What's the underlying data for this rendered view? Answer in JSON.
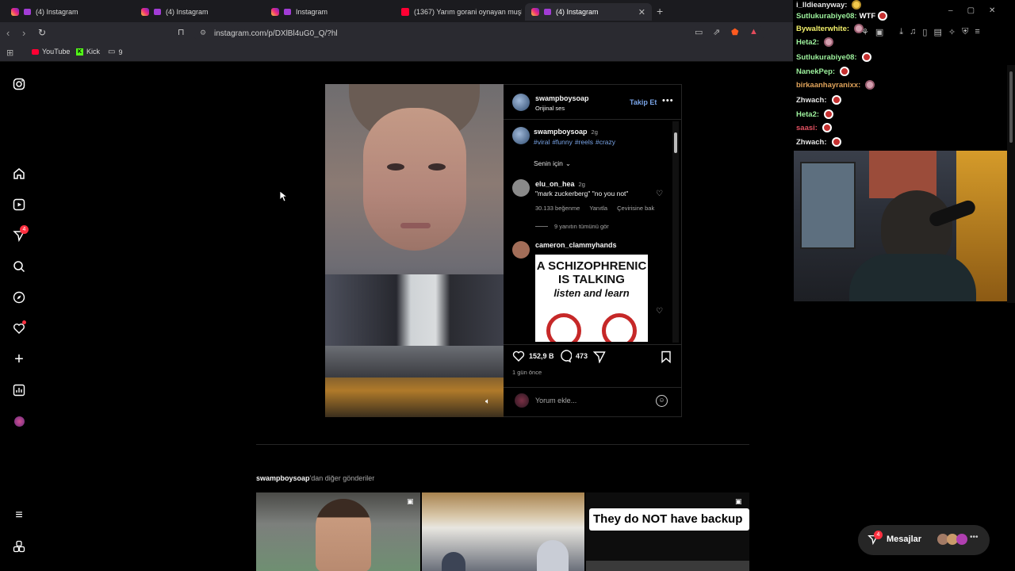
{
  "tabs": [
    {
      "label": "(4) Instagram",
      "icon": "instagram-icon"
    },
    {
      "label": "(4) Instagram",
      "icon": "instagram-icon"
    },
    {
      "label": "Instagram",
      "icon": "instagram-icon"
    },
    {
      "label": "(1367) Yarım gorani oynayan muşlu k",
      "icon": "youtube-icon"
    },
    {
      "label": "(4) Instagram",
      "icon": "instagram-icon"
    }
  ],
  "browser": {
    "url": "instagram.com/p/DXlBl4uG0_Q/?hl",
    "bookmarks": [
      {
        "label": "YouTube",
        "icon": "youtube-icon"
      },
      {
        "label": "Kick",
        "icon": "kick-icon"
      },
      {
        "label": "9",
        "icon": "folder-icon"
      }
    ]
  },
  "chat": [
    {
      "user": "i_lldieanyway:",
      "text": "",
      "color": "#e6e6e6"
    },
    {
      "user": "Sutlukurabiye08:",
      "text": "WTF",
      "color": "#9df29d"
    },
    {
      "user": "Bywalterwhite:",
      "text": "",
      "color": "#f2f06a"
    },
    {
      "user": "Heta2:",
      "text": "",
      "color": "#9df29d"
    },
    {
      "user": "Sutlukurabiye08:",
      "text": "",
      "color": "#9df29d"
    },
    {
      "user": "NanekPep:",
      "text": "",
      "color": "#9df29d"
    },
    {
      "user": "birkaanhayranixx:",
      "text": "",
      "color": "#e0a35a"
    },
    {
      "user": "Zhwach:",
      "text": "",
      "color": "#e6e6e6"
    },
    {
      "user": "Heta2:",
      "text": "",
      "color": "#9df29d"
    },
    {
      "user": "saasi:",
      "text": "",
      "color": "#e05060"
    },
    {
      "user": "Zhwach:",
      "text": "",
      "color": "#e6e6e6"
    }
  ],
  "post": {
    "author": "swampboysoap",
    "audio": "Orijinal ses",
    "follow_label": "Takip Et",
    "caption_user": "swampboysoap",
    "caption_age": "2g",
    "hashtags": [
      "#viral",
      "#funny",
      "#reels",
      "#crazy"
    ],
    "sort_label": "Senin için",
    "comments": [
      {
        "user": "elu_on_hea",
        "age": "2g",
        "text": "\"mark zuckerberg\" \"no you not\"",
        "likes": "30.133 beğenme",
        "reply": "Yanıtla",
        "translate": "Çevirisine bak",
        "replies": "9 yanıtın tümünü gör"
      },
      {
        "user": "cameron_clammyhands",
        "meme_line1": "A SCHIZOPHRENIC",
        "meme_line2": "IS TALKING",
        "meme_line3": "listen and learn"
      }
    ],
    "likes": "152,9 B",
    "comments_count": "473",
    "time": "1 gün önce",
    "comment_placeholder": "Yorum ekle..."
  },
  "more_posts": {
    "user": "swampboysoap",
    "suffix": "'dan diğer gönderiler",
    "thumb3_text": "They do NOT have backup"
  },
  "messages": {
    "label": "Mesajlar",
    "badge": "4"
  },
  "sidebar": {
    "notif_badge": "4"
  },
  "colors": {
    "accent": "#0095f6",
    "link": "#79a4e7",
    "badge": "#ff3040"
  }
}
